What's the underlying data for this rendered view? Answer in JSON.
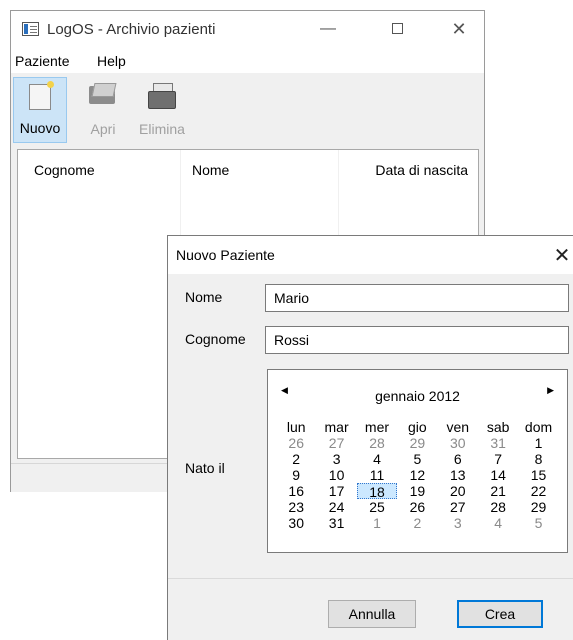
{
  "window": {
    "title": "LogOS - Archivio pazienti",
    "controls": {
      "minimize": "—",
      "maximize": "",
      "close": "✕"
    }
  },
  "menu": [
    "Paziente",
    "Help"
  ],
  "toolbar": [
    {
      "label": "Nuovo",
      "icon": "new-document-icon",
      "enabled": true
    },
    {
      "label": "Apri",
      "icon": "open-folder-icon",
      "enabled": false
    },
    {
      "label": "Elimina",
      "icon": "printer-icon",
      "enabled": false
    }
  ],
  "table": {
    "columns": [
      "Cognome",
      "Nome",
      "Data di nascita"
    ]
  },
  "dialog": {
    "title": "Nuovo Paziente",
    "close": "✕",
    "fields": {
      "nome": {
        "label": "Nome",
        "value": "Mario"
      },
      "cognome": {
        "label": "Cognome",
        "value": "Rossi"
      },
      "nato": {
        "label": "Nato il"
      }
    },
    "calendar": {
      "prev": "◀",
      "next": "▶",
      "month_label": "gennaio 2012",
      "weekdays": [
        "lun",
        "mar",
        "mer",
        "gio",
        "ven",
        "sab",
        "dom"
      ],
      "weeks": [
        [
          "26",
          "27",
          "28",
          "29",
          "30",
          "31",
          "1"
        ],
        [
          "2",
          "3",
          "4",
          "5",
          "6",
          "7",
          "8"
        ],
        [
          "9",
          "10",
          "11",
          "12",
          "13",
          "14",
          "15"
        ],
        [
          "16",
          "17",
          "18",
          "19",
          "20",
          "21",
          "22"
        ],
        [
          "23",
          "24",
          "25",
          "26",
          "27",
          "28",
          "29"
        ],
        [
          "30",
          "31",
          "1",
          "2",
          "3",
          "4",
          "5"
        ]
      ],
      "selected": "18",
      "selected_color": "#cce8ff"
    },
    "buttons": {
      "cancel": "Annulla",
      "ok": "Crea"
    },
    "accent": "#0078d7"
  }
}
